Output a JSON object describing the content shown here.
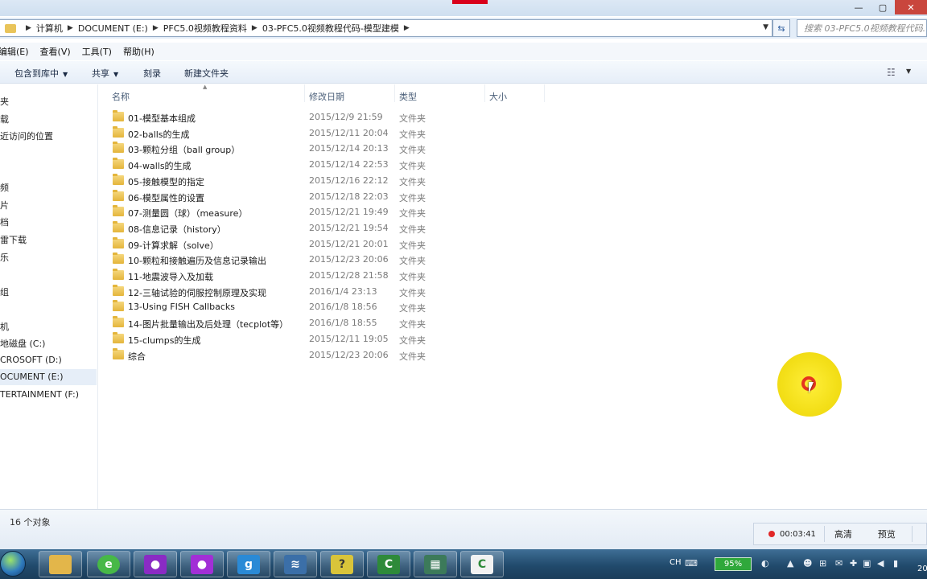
{
  "address": {
    "crumbs": [
      "计算机",
      "DOCUMENT (E:)",
      "PFC5.0视频教程资料",
      "03-PFC5.0视频教程代码-模型建模"
    ],
    "search_placeholder": "搜索 03-PFC5.0视频教程代码..."
  },
  "menu": [
    "编辑(E)",
    "查看(V)",
    "工具(T)",
    "帮助(H)"
  ],
  "commands": {
    "include_library": "包含到库中",
    "share": "共享",
    "burn": "刻录",
    "new_folder": "新建文件夹"
  },
  "nav": {
    "items": [
      "夹",
      "载",
      "近访问的位置",
      "频",
      "片",
      "档",
      "雷下载",
      "乐",
      "组",
      "机",
      "地磁盘 (C:)",
      "CROSOFT (D:)",
      "OCUMENT (E:)",
      "TERTAINMENT (F:)"
    ],
    "selected_index": 12
  },
  "columns": {
    "name": "名称",
    "date": "修改日期",
    "type": "类型",
    "size": "大小"
  },
  "files": [
    {
      "name": "01-模型基本组成",
      "date": "2015/12/9 21:59",
      "type": "文件夹"
    },
    {
      "name": "02-balls的生成",
      "date": "2015/12/11 20:04",
      "type": "文件夹"
    },
    {
      "name": "03-颗粒分组（ball group）",
      "date": "2015/12/14 20:13",
      "type": "文件夹"
    },
    {
      "name": "04-walls的生成",
      "date": "2015/12/14 22:53",
      "type": "文件夹"
    },
    {
      "name": "05-接触模型的指定",
      "date": "2015/12/16 22:12",
      "type": "文件夹"
    },
    {
      "name": "06-模型属性的设置",
      "date": "2015/12/18 22:03",
      "type": "文件夹"
    },
    {
      "name": "07-测量圆（球）（measure）",
      "date": "2015/12/21 19:49",
      "type": "文件夹"
    },
    {
      "name": "08-信息记录（history）",
      "date": "2015/12/21 19:54",
      "type": "文件夹"
    },
    {
      "name": "09-计算求解（solve）",
      "date": "2015/12/21 20:01",
      "type": "文件夹"
    },
    {
      "name": "10-颗粒和接触遍历及信息记录输出",
      "date": "2015/12/23 20:06",
      "type": "文件夹"
    },
    {
      "name": "11-地震波导入及加载",
      "date": "2015/12/28 21:58",
      "type": "文件夹"
    },
    {
      "name": "12-三轴试验的伺服控制原理及实现",
      "date": "2016/1/4 23:13",
      "type": "文件夹"
    },
    {
      "name": "13-Using FISH Callbacks",
      "date": "2016/1/8 18:56",
      "type": "文件夹"
    },
    {
      "name": "14-图片批量输出及后处理（tecplot等）",
      "date": "2016/1/8 18:55",
      "type": "文件夹"
    },
    {
      "name": "15-clumps的生成",
      "date": "2015/12/11 19:05",
      "type": "文件夹"
    },
    {
      "name": "综合",
      "date": "2015/12/23 20:06",
      "type": "文件夹"
    }
  ],
  "status": {
    "count": "16 个对象"
  },
  "recorder": {
    "time": "00:03:41",
    "hd": "高清",
    "preview": "预览"
  },
  "taskbar": {
    "input_lang": "CH",
    "battery": "95%",
    "clock_partial": "20"
  },
  "colors": {
    "accent": "#2d5d9e",
    "folder": "#e4b53b",
    "record": "#e12727",
    "cursor_highlight": "#f3df18"
  }
}
